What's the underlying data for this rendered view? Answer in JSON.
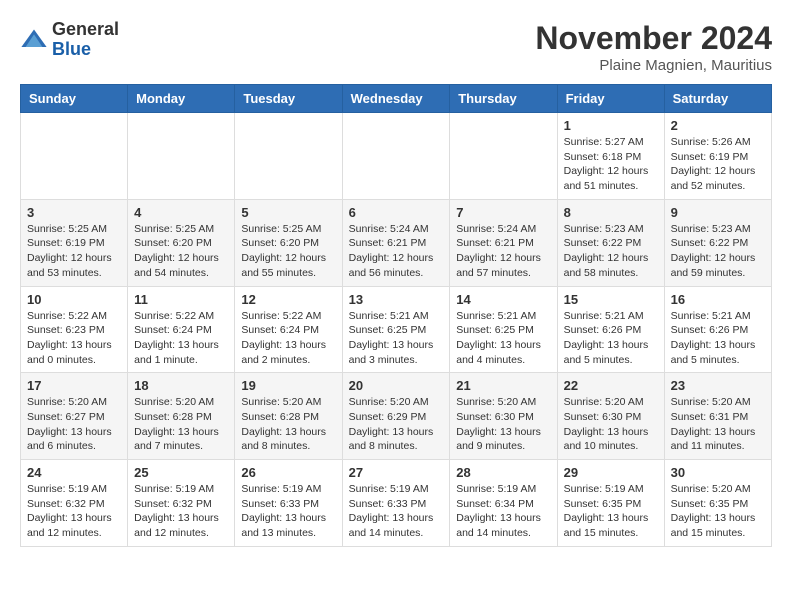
{
  "header": {
    "logo_general": "General",
    "logo_blue": "Blue",
    "month_title": "November 2024",
    "location": "Plaine Magnien, Mauritius"
  },
  "calendar": {
    "days_of_week": [
      "Sunday",
      "Monday",
      "Tuesday",
      "Wednesday",
      "Thursday",
      "Friday",
      "Saturday"
    ],
    "weeks": [
      {
        "days": [
          {
            "number": "",
            "info": ""
          },
          {
            "number": "",
            "info": ""
          },
          {
            "number": "",
            "info": ""
          },
          {
            "number": "",
            "info": ""
          },
          {
            "number": "",
            "info": ""
          },
          {
            "number": "1",
            "info": "Sunrise: 5:27 AM\nSunset: 6:18 PM\nDaylight: 12 hours and 51 minutes."
          },
          {
            "number": "2",
            "info": "Sunrise: 5:26 AM\nSunset: 6:19 PM\nDaylight: 12 hours and 52 minutes."
          }
        ]
      },
      {
        "days": [
          {
            "number": "3",
            "info": "Sunrise: 5:25 AM\nSunset: 6:19 PM\nDaylight: 12 hours and 53 minutes."
          },
          {
            "number": "4",
            "info": "Sunrise: 5:25 AM\nSunset: 6:20 PM\nDaylight: 12 hours and 54 minutes."
          },
          {
            "number": "5",
            "info": "Sunrise: 5:25 AM\nSunset: 6:20 PM\nDaylight: 12 hours and 55 minutes."
          },
          {
            "number": "6",
            "info": "Sunrise: 5:24 AM\nSunset: 6:21 PM\nDaylight: 12 hours and 56 minutes."
          },
          {
            "number": "7",
            "info": "Sunrise: 5:24 AM\nSunset: 6:21 PM\nDaylight: 12 hours and 57 minutes."
          },
          {
            "number": "8",
            "info": "Sunrise: 5:23 AM\nSunset: 6:22 PM\nDaylight: 12 hours and 58 minutes."
          },
          {
            "number": "9",
            "info": "Sunrise: 5:23 AM\nSunset: 6:22 PM\nDaylight: 12 hours and 59 minutes."
          }
        ]
      },
      {
        "days": [
          {
            "number": "10",
            "info": "Sunrise: 5:22 AM\nSunset: 6:23 PM\nDaylight: 13 hours and 0 minutes."
          },
          {
            "number": "11",
            "info": "Sunrise: 5:22 AM\nSunset: 6:24 PM\nDaylight: 13 hours and 1 minute."
          },
          {
            "number": "12",
            "info": "Sunrise: 5:22 AM\nSunset: 6:24 PM\nDaylight: 13 hours and 2 minutes."
          },
          {
            "number": "13",
            "info": "Sunrise: 5:21 AM\nSunset: 6:25 PM\nDaylight: 13 hours and 3 minutes."
          },
          {
            "number": "14",
            "info": "Sunrise: 5:21 AM\nSunset: 6:25 PM\nDaylight: 13 hours and 4 minutes."
          },
          {
            "number": "15",
            "info": "Sunrise: 5:21 AM\nSunset: 6:26 PM\nDaylight: 13 hours and 5 minutes."
          },
          {
            "number": "16",
            "info": "Sunrise: 5:21 AM\nSunset: 6:26 PM\nDaylight: 13 hours and 5 minutes."
          }
        ]
      },
      {
        "days": [
          {
            "number": "17",
            "info": "Sunrise: 5:20 AM\nSunset: 6:27 PM\nDaylight: 13 hours and 6 minutes."
          },
          {
            "number": "18",
            "info": "Sunrise: 5:20 AM\nSunset: 6:28 PM\nDaylight: 13 hours and 7 minutes."
          },
          {
            "number": "19",
            "info": "Sunrise: 5:20 AM\nSunset: 6:28 PM\nDaylight: 13 hours and 8 minutes."
          },
          {
            "number": "20",
            "info": "Sunrise: 5:20 AM\nSunset: 6:29 PM\nDaylight: 13 hours and 8 minutes."
          },
          {
            "number": "21",
            "info": "Sunrise: 5:20 AM\nSunset: 6:30 PM\nDaylight: 13 hours and 9 minutes."
          },
          {
            "number": "22",
            "info": "Sunrise: 5:20 AM\nSunset: 6:30 PM\nDaylight: 13 hours and 10 minutes."
          },
          {
            "number": "23",
            "info": "Sunrise: 5:20 AM\nSunset: 6:31 PM\nDaylight: 13 hours and 11 minutes."
          }
        ]
      },
      {
        "days": [
          {
            "number": "24",
            "info": "Sunrise: 5:19 AM\nSunset: 6:32 PM\nDaylight: 13 hours and 12 minutes."
          },
          {
            "number": "25",
            "info": "Sunrise: 5:19 AM\nSunset: 6:32 PM\nDaylight: 13 hours and 12 minutes."
          },
          {
            "number": "26",
            "info": "Sunrise: 5:19 AM\nSunset: 6:33 PM\nDaylight: 13 hours and 13 minutes."
          },
          {
            "number": "27",
            "info": "Sunrise: 5:19 AM\nSunset: 6:33 PM\nDaylight: 13 hours and 14 minutes."
          },
          {
            "number": "28",
            "info": "Sunrise: 5:19 AM\nSunset: 6:34 PM\nDaylight: 13 hours and 14 minutes."
          },
          {
            "number": "29",
            "info": "Sunrise: 5:19 AM\nSunset: 6:35 PM\nDaylight: 13 hours and 15 minutes."
          },
          {
            "number": "30",
            "info": "Sunrise: 5:20 AM\nSunset: 6:35 PM\nDaylight: 13 hours and 15 minutes."
          }
        ]
      }
    ]
  }
}
